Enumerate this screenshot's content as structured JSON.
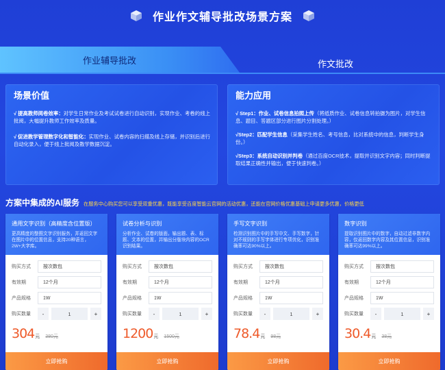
{
  "header": {
    "title": "作业作文辅导批改场景方案"
  },
  "tabs": [
    {
      "label": "作业辅导批改",
      "active": true
    },
    {
      "label": "作文批改",
      "active": false
    }
  ],
  "scene": {
    "title": "场景价值",
    "items": [
      {
        "lead": "√ 提高教师阅卷效率：",
        "text": "对学生日常作业及考试试卷进行自动识别，实现作业、考卷的线上批阅，大幅提升教师工作效率及质量。"
      },
      {
        "lead": "√ 促进教学管理数字化和智能化：",
        "text": "实现作业、试卷内容的扫描及线上存储，并识别后进行自动化录入，便于线上批阅及教学数据沉淀。"
      }
    ]
  },
  "capability": {
    "title": "能力应用",
    "items": [
      {
        "lead": "√ Step1：作业、试卷信息拍照上传",
        "text": "（将纸质作业、试卷信息转拍摄为图片，对学生信息、题目、答题区部分进行图片分割处理。）"
      },
      {
        "lead": "√Step2：匹配学生信息",
        "text": "（采集学生姓名、考号信息，比对系统中的信息，判断学生身份。）"
      },
      {
        "lead": "√Step3：系统自动识别并判卷",
        "text": "（通过百度OCR技术，提取并识别文字内容；同时判断提取结果正确性并输出，便于快速判卷。）"
      }
    ]
  },
  "services": {
    "title": "方案中集成的AI服务",
    "note": "在服务中心购买您可以享受双重优惠，既能享受百度智能云官网的活动优惠，还能在官网价格优惠基础上申请更多优惠，价格更低",
    "labels": {
      "buy_type": "购买方式",
      "validity": "有效期",
      "spec": "产品规格",
      "qty": "购买数量",
      "minus": "-",
      "plus": "+",
      "unit": "元",
      "buy": "立即抢购"
    },
    "cards": [
      {
        "name": "通用文字识别（高精度含位置版）",
        "desc": "更高精度的整图文字识别服务，并返回文字在图片中的位置信息，支持20种语言，2W+大字库。",
        "buy_type": "按次数包",
        "validity": "12个月",
        "spec": "1W",
        "qty": "1",
        "price": "304",
        "orig": "380元"
      },
      {
        "name": "试卷分析与识别",
        "desc": "分析作业、试卷的版面，输出题、表、标题、文本的位置，并输出分版块内容的OCR识别结果。",
        "buy_type": "按次数包",
        "validity": "12个月",
        "spec": "1W",
        "qty": "1",
        "price": "1200",
        "orig": "1500元"
      },
      {
        "name": "手写文字识别",
        "desc": "检测识别图片中的手写中文、手写数字，针对不规则的手写字体进行专项优化，识别准确率可达90%以上。",
        "buy_type": "按次数包",
        "validity": "12个月",
        "spec": "1W",
        "qty": "1",
        "price": "78.4",
        "orig": "98元"
      },
      {
        "name": "数字识别",
        "desc": "提取识别图片中的数字，自动过滤非数字内容，仅返回数字内容及其位置信息，识别准确率可达99%以上。",
        "buy_type": "按次数包",
        "validity": "12个月",
        "spec": "1W",
        "qty": "1",
        "price": "30.4",
        "orig": "38元"
      }
    ]
  }
}
